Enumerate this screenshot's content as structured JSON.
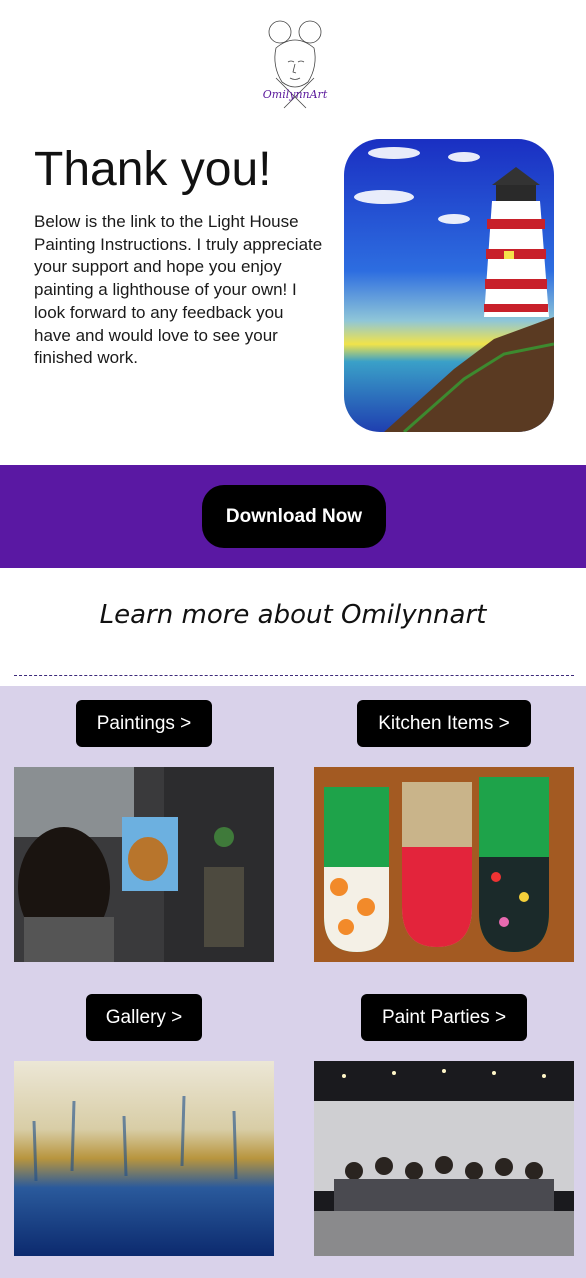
{
  "logo": {
    "text": "OmilynnArt"
  },
  "hero": {
    "title": "Thank you!",
    "body": "Below is the link to the Light House Painting Instructions. I truly appreciate your support and hope you enjoy painting a lighthouse of your own! I look forward to any feedback you have and would love to see your finished work.",
    "image": "lighthouse-painting"
  },
  "cta": {
    "label": "Download Now"
  },
  "learn_more": {
    "heading": "Learn more about Omilynnart"
  },
  "colors": {
    "band": "#5a18a3",
    "grid_bg": "#d9d2ea",
    "button": "#000000",
    "logo_text": "#5b1a9c"
  },
  "categories": [
    {
      "label": "Paintings >",
      "image": "artist-painting-photo"
    },
    {
      "label": "Kitchen Items >",
      "image": "oven-mitts-photo"
    },
    {
      "label": "Gallery >",
      "image": "abstract-painting-photo"
    },
    {
      "label": "Paint Parties >",
      "image": "paint-party-group-photo"
    }
  ]
}
